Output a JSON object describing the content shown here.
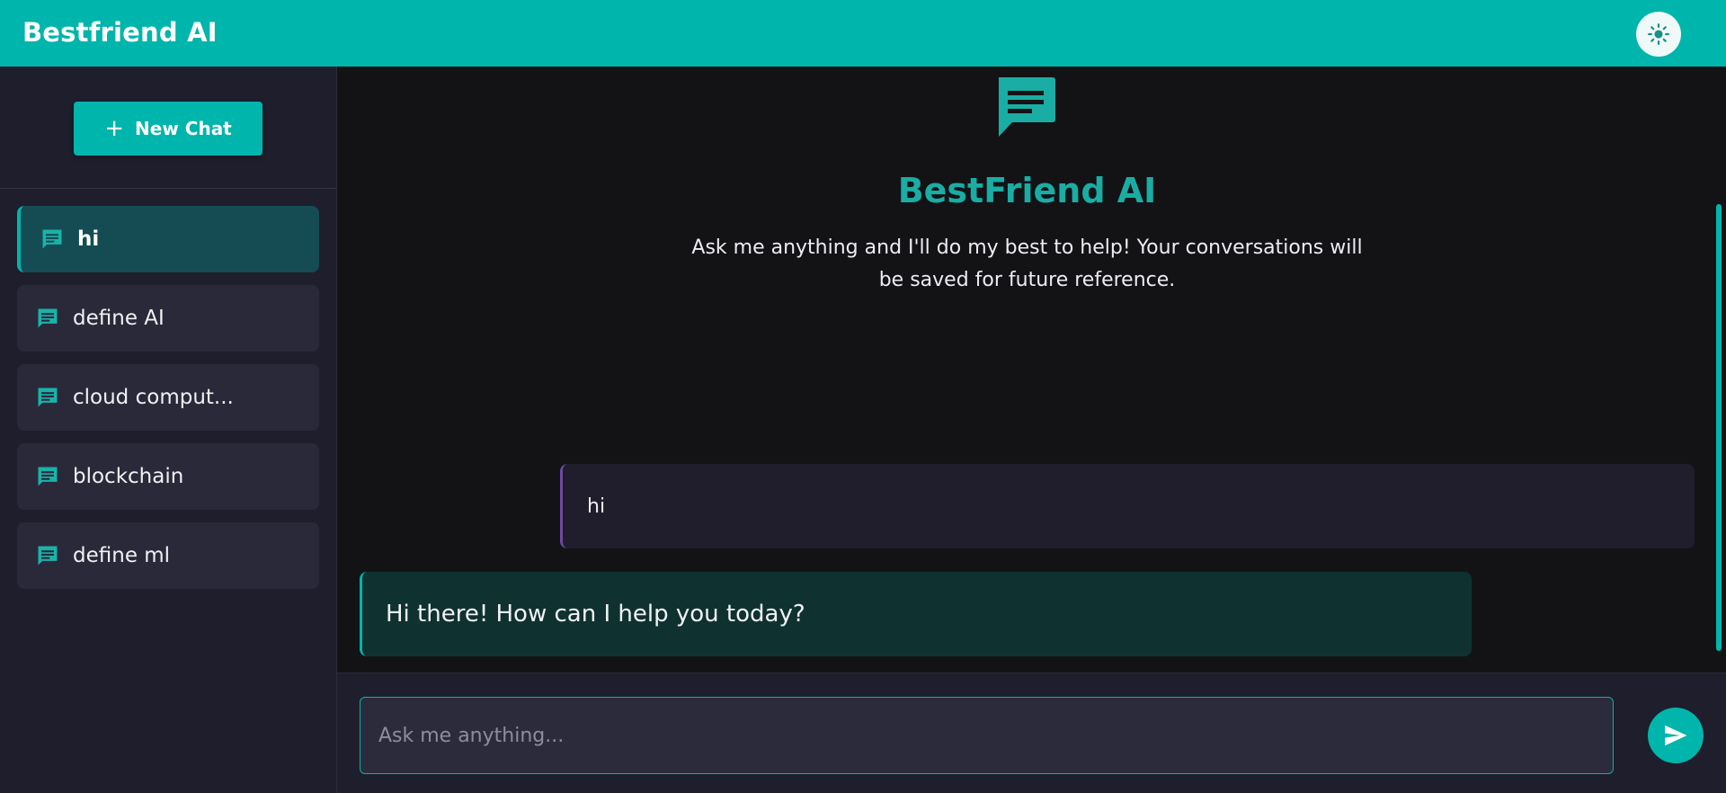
{
  "app": {
    "title": "Bestfriend AI"
  },
  "header": {
    "theme_toggle_icon": "sun-icon"
  },
  "sidebar": {
    "new_chat_label": "New Chat",
    "new_chat_icon": "plus-icon",
    "chats": [
      {
        "label": "hi",
        "active": true
      },
      {
        "label": "define AI",
        "active": false
      },
      {
        "label": "cloud comput...",
        "active": false
      },
      {
        "label": "blockchain",
        "active": false
      },
      {
        "label": "define ml",
        "active": false
      }
    ]
  },
  "welcome": {
    "icon": "chat-bubble-icon",
    "title": "BestFriend AI",
    "subtitle": "Ask me anything and I'll do my best to help! Your conversations will be saved for future reference."
  },
  "messages": [
    {
      "role": "user",
      "text": "hi"
    },
    {
      "role": "assistant",
      "text": "Hi there! How can I help you today?"
    }
  ],
  "composer": {
    "placeholder": "Ask me anything...",
    "value": "",
    "send_icon": "send-icon"
  },
  "colors": {
    "accent": "#00b5ab",
    "header_bg": "#00b5ab",
    "sidebar_bg": "#1e1e2c",
    "main_bg": "#131316",
    "user_accent": "#6d4aa4"
  }
}
